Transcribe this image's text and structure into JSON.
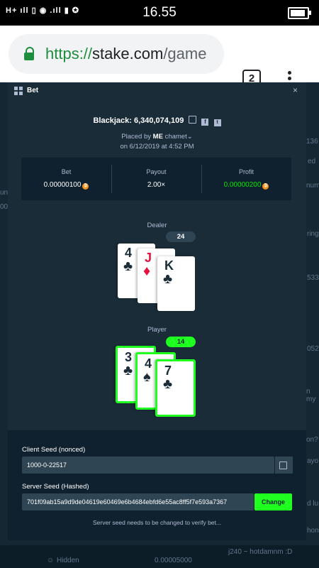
{
  "status_bar": {
    "carrier_text": "H+ ıll ▯ ◉ .ıll ▮ ✪",
    "time": "16.55",
    "battery_level_pct": 90
  },
  "browser": {
    "url_scheme": "https://",
    "url_host": "stake.com",
    "url_path": "/game",
    "tab_count": "2"
  },
  "background": {
    "hidden_user": "Hidden",
    "hidden_amount": "0.00005000",
    "chat_message": "j240 ~ hotdamnm :D",
    "fragments": [
      "136",
      "ed",
      "num",
      "unt",
      "00",
      "ring",
      "533",
      "052",
      "n my",
      "on?",
      "ayo",
      "d lu",
      "hon'"
    ]
  },
  "modal": {
    "title": "Bet",
    "close": "×",
    "game_title": "Blackjack: 6,340,074,109",
    "placed_by_prefix": "Placed by",
    "placed_by_user_prefix": "ME",
    "placed_by_user": "chamet",
    "date_line": "on 6/12/2019 at 4:52 PM",
    "stats": [
      {
        "label": "Bet",
        "value": "0.00000100",
        "green": false
      },
      {
        "label": "Payout",
        "value": "2.00×",
        "green": false
      },
      {
        "label": "Profit",
        "value": "0.00000200",
        "green": true
      }
    ],
    "dealer": {
      "label": "Dealer",
      "total": "24",
      "cards": [
        {
          "rank": "4",
          "suit": "♣",
          "red": false
        },
        {
          "rank": "J",
          "suit": "♦",
          "red": true
        },
        {
          "rank": "K",
          "suit": "♣",
          "red": false
        }
      ]
    },
    "player": {
      "label": "Player",
      "total": "14",
      "cards": [
        {
          "rank": "3",
          "suit": "♣",
          "red": false
        },
        {
          "rank": "4",
          "suit": "♠",
          "red": false
        },
        {
          "rank": "7",
          "suit": "♣",
          "red": false
        }
      ]
    },
    "client_seed_label": "Client Seed (nonced)",
    "client_seed_value": "1000-0-22517",
    "server_seed_label": "Server Seed (Hashed)",
    "server_seed_value": "701f09ab15a9d9de04619e60469e6b4684ebfd6e55ac8ff5f7e593a7367",
    "change_label": "Change",
    "verify_note": "Server seed needs to be changed to verify bet..."
  },
  "colors": {
    "accent_green": "#1fff20",
    "panel": "#1a2c38",
    "dark": "#0f212e",
    "btc": "#f7931a"
  }
}
